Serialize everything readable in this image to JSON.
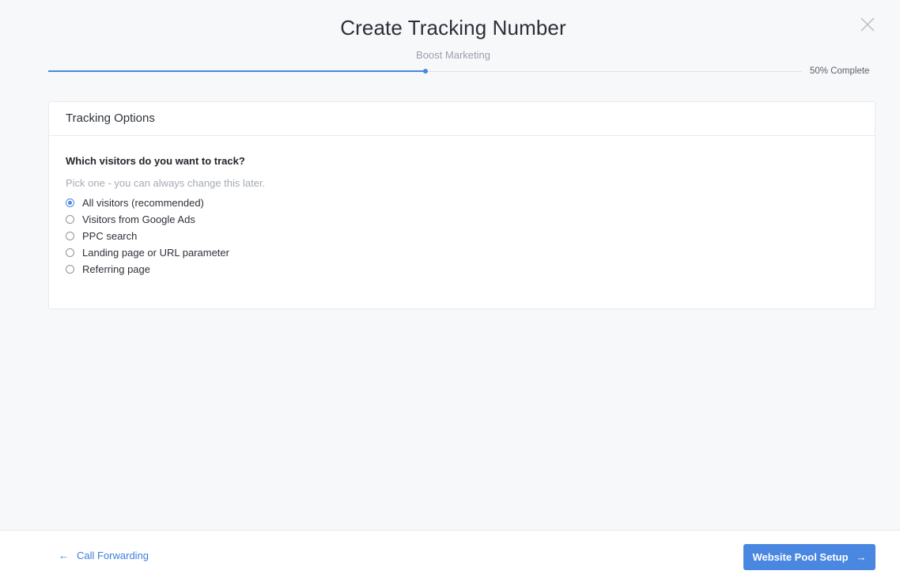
{
  "modal": {
    "title": "Create Tracking Number",
    "subtitle": "Boost Marketing",
    "close_icon": "close-icon"
  },
  "progress": {
    "percent": 50,
    "label": "50% Complete"
  },
  "tracking_options": {
    "header": "Tracking Options",
    "question": "Which visitors do you want to track?",
    "hint": "Pick one - you can always change this later.",
    "selected_index": 0,
    "options": [
      {
        "label": "All visitors (recommended)"
      },
      {
        "label": "Visitors from Google Ads"
      },
      {
        "label": "PPC search"
      },
      {
        "label": "Landing page or URL parameter"
      },
      {
        "label": "Referring page"
      }
    ]
  },
  "footer": {
    "back_label": "Call Forwarding",
    "back_icon": "arrow-left-icon",
    "next_label": "Website Pool Setup",
    "next_icon": "arrow-right-icon"
  },
  "colors": {
    "accent": "#4a87e0",
    "background": "#f7f8fa"
  }
}
